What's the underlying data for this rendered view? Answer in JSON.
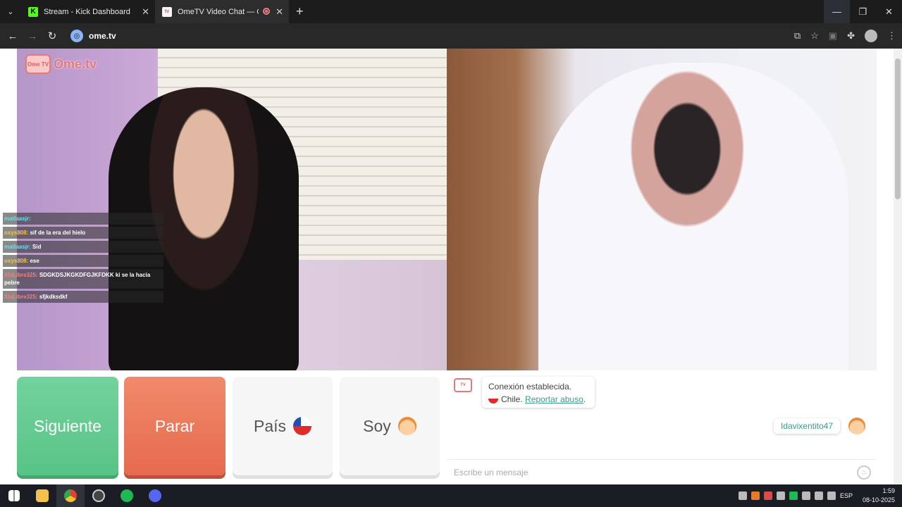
{
  "browser": {
    "tabs": [
      {
        "title": "Stream - Kick Dashboard",
        "icon": "kick-icon"
      },
      {
        "title": "OmeTV Video Chat — Ome",
        "icon": "ometv-icon"
      }
    ],
    "url": "ome.tv",
    "colors": {
      "tabbar": "#1c1c1c",
      "addrbar": "#282828"
    }
  },
  "logo": {
    "tv": "Ome TV",
    "text": "Ome.tv"
  },
  "stream_chat": [
    {
      "user": "matiaasjr:",
      "text": "",
      "color": "#6ee0e8"
    },
    {
      "user": "oxys808:",
      "text": "sif de la era del hielo",
      "color": "#f5c542"
    },
    {
      "user": "matiaasjr:",
      "text": "Sid",
      "color": "#6ee0e8"
    },
    {
      "user": "oxys808:",
      "text": "ese",
      "color": "#f5c542"
    },
    {
      "user": "XlaLibre325:",
      "text": "SDGKDSJKGKDFGJKFDKK ki se la hacia pebre",
      "color": "#f08080"
    },
    {
      "user": "XlaLibre325:",
      "text": "sfjkdksdkf",
      "color": "#f08080"
    }
  ],
  "controls": {
    "next": "Siguiente",
    "stop": "Parar",
    "country": "País",
    "gender": "Soy"
  },
  "chat": {
    "system_line1": "Conexión establecida.",
    "system_country": "Chile.",
    "report": "Reportar abuso",
    "user_tag": "Idavixentito47",
    "placeholder": "Escribe un mensaje"
  },
  "taskbar": {
    "lang": "ESP",
    "time": "1:59",
    "date": "08-10-2025"
  }
}
